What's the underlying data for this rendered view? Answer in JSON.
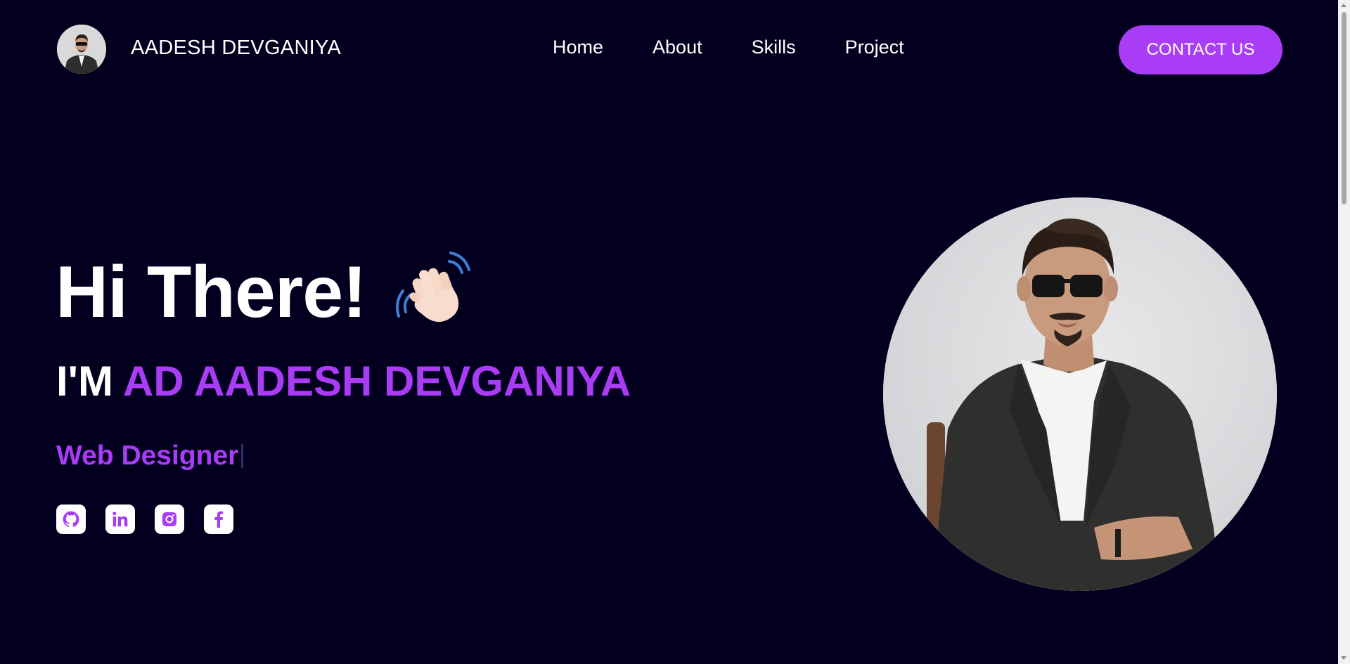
{
  "header": {
    "brand": "AADESH DEVGANIYA",
    "nav": [
      "Home",
      "About",
      "Skills",
      "Project"
    ],
    "contact_label": "CONTACT US"
  },
  "hero": {
    "greeting": "Hi There!",
    "greeting_icon": "waving-hand-icon",
    "im_prefix": "I'M",
    "name": "AD AADESH DEVGANIYA",
    "role": "Web Designer",
    "socials": [
      {
        "icon": "github-icon"
      },
      {
        "icon": "linkedin-icon"
      },
      {
        "icon": "instagram-icon"
      },
      {
        "icon": "facebook-icon"
      }
    ]
  },
  "colors": {
    "background": "#03001f",
    "accent": "#a93cf5",
    "text": "#ffffff"
  }
}
